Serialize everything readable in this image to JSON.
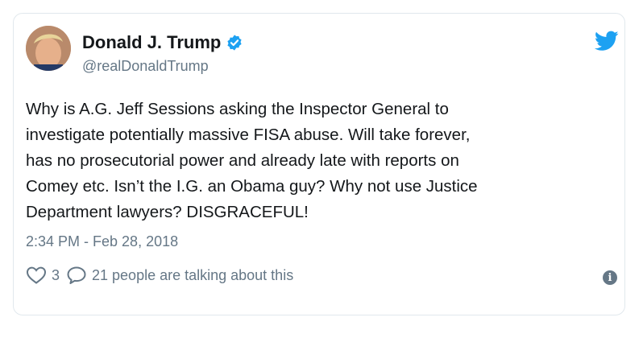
{
  "tweet": {
    "author": {
      "name": "Donald J. Trump",
      "handle": "@realDonaldTrump",
      "verified": true
    },
    "text": "Why is A.G. Jeff Sessions asking the Inspector General to\ninvestigate potentially massive FISA abuse. Will take forever,\nhas no prosecutorial power and already late with reports on\nComey etc. Isn’t the I.G. an Obama guy? Why not use Justice\nDepartment lawyers? DISGRACEFUL!",
    "timestamp": "2:34 PM - Feb 28, 2018",
    "likes": "3",
    "conversation": "21 people are talking about this"
  },
  "icons": {
    "brand": "twitter-bird-icon",
    "verified": "verified-badge-icon",
    "like": "heart-icon",
    "reply": "speech-bubble-icon",
    "info": "info-icon"
  },
  "colors": {
    "brand": "#1da1f2",
    "secondary_text": "#657786",
    "border": "#e1e8ed"
  }
}
